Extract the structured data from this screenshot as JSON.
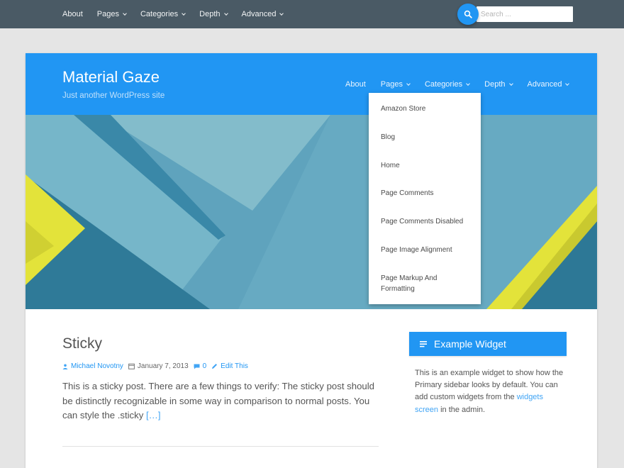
{
  "topbar": {
    "nav": [
      {
        "label": "About",
        "has_dropdown": false
      },
      {
        "label": "Pages",
        "has_dropdown": true
      },
      {
        "label": "Categories",
        "has_dropdown": true
      },
      {
        "label": "Depth",
        "has_dropdown": true
      },
      {
        "label": "Advanced",
        "has_dropdown": true
      }
    ],
    "search": {
      "placeholder": "Search ...",
      "value": "",
      "icon": "search-icon"
    }
  },
  "header": {
    "site_title": "Material Gaze",
    "tagline": "Just another WordPress site",
    "nav": [
      {
        "label": "About",
        "has_dropdown": false
      },
      {
        "label": "Pages",
        "has_dropdown": true
      },
      {
        "label": "Categories",
        "has_dropdown": true
      },
      {
        "label": "Depth",
        "has_dropdown": true
      },
      {
        "label": "Advanced",
        "has_dropdown": true
      }
    ]
  },
  "pages_dropdown": {
    "items": [
      "Amazon Store",
      "Blog",
      "Home",
      "Page Comments",
      "Page Comments Disabled",
      "Page Image Alignment",
      "Page Markup And Formatting"
    ]
  },
  "post": {
    "title": "Sticky",
    "author": "Michael Novotny",
    "date": "January 7, 2013",
    "comments": "0",
    "edit_label": "Edit This",
    "excerpt": "This is a sticky post. There are a few things to verify: The sticky post should be distinctly recognizable in some way in comparison to normal posts. You can style the .sticky",
    "more_label": "[…]"
  },
  "widget": {
    "title": "Example Widget",
    "text_before": "This is an example widget to show how the Primary sidebar looks by default. You can add custom widgets from the",
    "link": "widgets screen",
    "text_after": "in the admin."
  },
  "colors": {
    "topbar": "#4a5a65",
    "primary": "#2196f3",
    "page_bg": "#e5e5e5",
    "accent_yellow": "#e3e33a"
  }
}
